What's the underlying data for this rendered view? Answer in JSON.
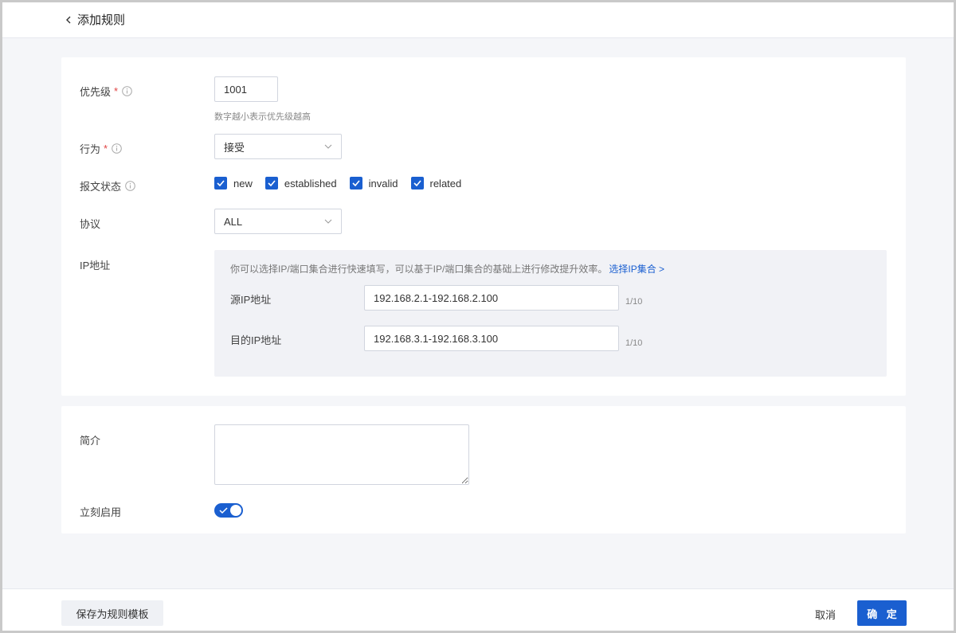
{
  "header": {
    "back_icon": "chevron-left-icon",
    "title": "添加规则"
  },
  "form": {
    "priority": {
      "label": "优先级",
      "required_mark": "*",
      "value": "1001",
      "hint": "数字越小表示优先级越高"
    },
    "action": {
      "label": "行为",
      "required_mark": "*",
      "selected": "接受"
    },
    "packet_state": {
      "label": "报文状态",
      "options": [
        {
          "label": "new",
          "checked": true
        },
        {
          "label": "established",
          "checked": true
        },
        {
          "label": "invalid",
          "checked": true
        },
        {
          "label": "related",
          "checked": true
        }
      ]
    },
    "protocol": {
      "label": "协议",
      "selected": "ALL"
    },
    "ip": {
      "label": "IP地址",
      "description": "你可以选择IP/端口集合进行快速填写，可以基于IP/端口集合的基础上进行修改提升效率。",
      "link": "选择IP集合 >",
      "source": {
        "label": "源IP地址",
        "value": "192.168.2.1-192.168.2.100",
        "count": "1/10"
      },
      "destination": {
        "label": "目的IP地址",
        "value": "192.168.3.1-192.168.3.100",
        "count": "1/10"
      }
    },
    "intro": {
      "label": "简介",
      "value": ""
    },
    "enable_now": {
      "label": "立刻启用",
      "on": true
    }
  },
  "footer": {
    "save_template": "保存为规则模板",
    "cancel": "取消",
    "confirm": "确 定"
  },
  "colors": {
    "primary": "#1a5fd0",
    "required": "#e04343",
    "background": "#f5f6f9"
  }
}
